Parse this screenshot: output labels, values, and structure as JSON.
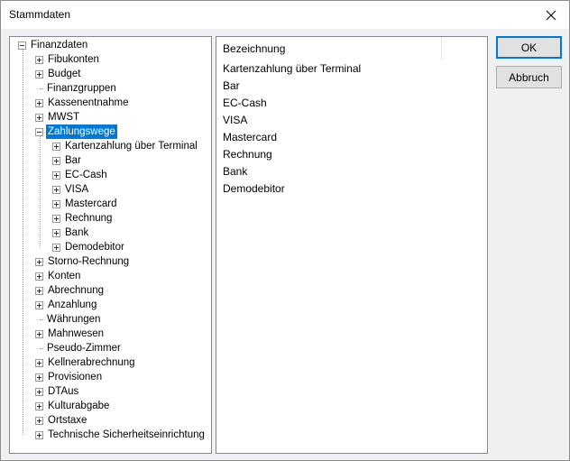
{
  "window": {
    "title": "Stammdaten",
    "close_icon": "close-icon"
  },
  "tree": {
    "root": "Finanzdaten",
    "items": [
      {
        "label": "Fibukonten",
        "expander": true
      },
      {
        "label": "Budget",
        "expander": true
      },
      {
        "label": "Finanzgruppen",
        "expander": false
      },
      {
        "label": "Kassenentnahme",
        "expander": true
      },
      {
        "label": "MWST",
        "expander": true
      },
      {
        "label": "Zahlungswege",
        "expander": true,
        "expanded": true,
        "selected": true
      },
      {
        "label": "Kartenzahlung über Terminal",
        "expander": true,
        "child": true
      },
      {
        "label": "Bar",
        "expander": true,
        "child": true
      },
      {
        "label": "EC-Cash",
        "expander": true,
        "child": true
      },
      {
        "label": "VISA",
        "expander": true,
        "child": true
      },
      {
        "label": "Mastercard",
        "expander": true,
        "child": true
      },
      {
        "label": "Rechnung",
        "expander": true,
        "child": true
      },
      {
        "label": "Bank",
        "expander": true,
        "child": true
      },
      {
        "label": "Demodebitor",
        "expander": true,
        "child": true
      },
      {
        "label": "Storno-Rechnung",
        "expander": true
      },
      {
        "label": "Konten",
        "expander": true
      },
      {
        "label": "Abrechnung",
        "expander": true
      },
      {
        "label": "Anzahlung",
        "expander": true
      },
      {
        "label": "Währungen",
        "expander": false
      },
      {
        "label": "Mahnwesen",
        "expander": true
      },
      {
        "label": "Pseudo-Zimmer",
        "expander": false
      },
      {
        "label": "Kellnerabrechnung",
        "expander": true
      },
      {
        "label": "Provisionen",
        "expander": true
      },
      {
        "label": "DTAus",
        "expander": true
      },
      {
        "label": "Kulturabgabe",
        "expander": true
      },
      {
        "label": "Ortstaxe",
        "expander": true
      },
      {
        "label": "Technische Sicherheitseinrichtung",
        "expander": true
      }
    ]
  },
  "list": {
    "header": "Bezeichnung",
    "items": [
      "Kartenzahlung über Terminal",
      "Bar",
      "EC-Cash",
      "VISA",
      "Mastercard",
      "Rechnung",
      "Bank",
      "Demodebitor"
    ]
  },
  "buttons": {
    "ok": "OK",
    "cancel": "Abbruch"
  },
  "colors": {
    "selection": "#0078d7",
    "default_button_border": "#0078d7"
  }
}
